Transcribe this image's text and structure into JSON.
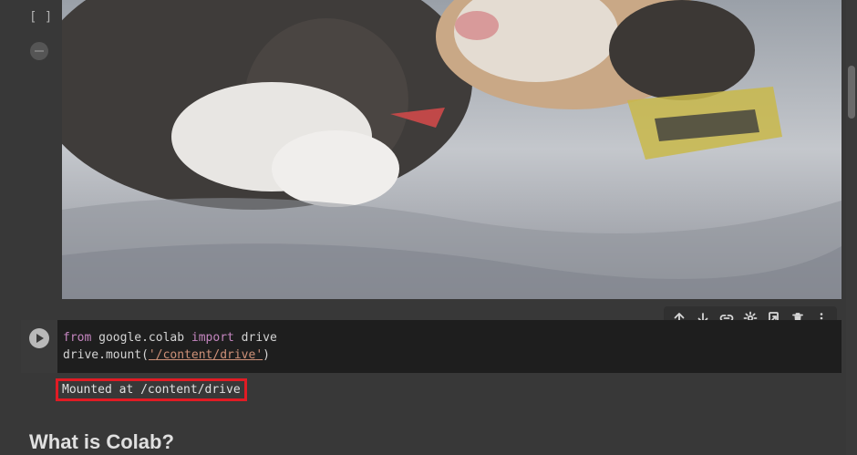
{
  "gutter": {
    "bracket": "[ ]"
  },
  "image_output": {
    "alt": "Kitten sleeping on a blanket"
  },
  "cell_toolbar": {
    "icons": [
      "arrow-up-icon",
      "arrow-down-icon",
      "link-icon",
      "gear-icon",
      "mirror-cell-icon",
      "trash-icon",
      "more-vert-icon"
    ]
  },
  "code_cell": {
    "line1": {
      "kw1": "from",
      "mod": " google.colab ",
      "kw2": "import",
      "name": " drive"
    },
    "line2": {
      "pre": "drive.mount(",
      "quote_open": "'",
      "path": "/content/drive",
      "quote_close": "'",
      "post": ")"
    },
    "output": "Mounted at /content/drive"
  },
  "section": {
    "heading": "What is Colab?"
  },
  "colors": {
    "highlight_border": "#e01b24",
    "keyword": "#c586c0",
    "string": "#ce9178"
  }
}
